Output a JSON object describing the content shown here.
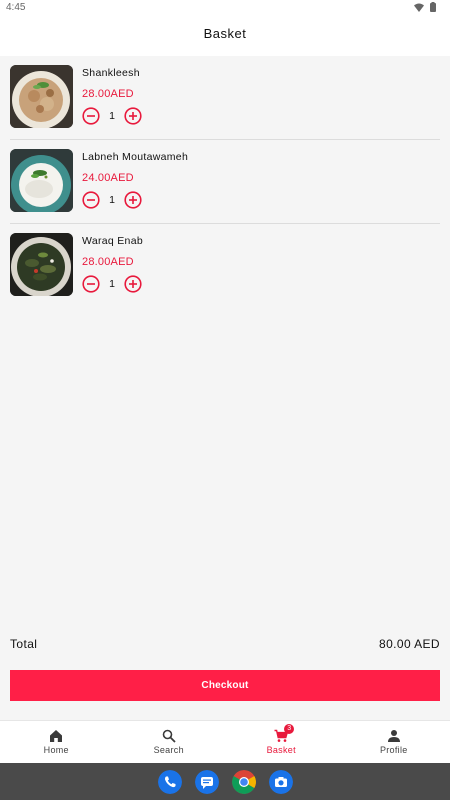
{
  "status_bar": {
    "time": "4:45"
  },
  "header": {
    "title": "Basket"
  },
  "items": [
    {
      "name": "Shankleesh",
      "price": "28.00AED",
      "quantity": "1"
    },
    {
      "name": "Labneh Moutawameh",
      "price": "24.00AED",
      "quantity": "1"
    },
    {
      "name": "Waraq Enab",
      "price": "28.00AED",
      "quantity": "1"
    }
  ],
  "summary": {
    "total_label": "Total",
    "total_value": "80.00 AED",
    "checkout_label": "Checkout"
  },
  "nav": {
    "items": [
      {
        "label": "Home",
        "icon": "home-icon"
      },
      {
        "label": "Search",
        "icon": "search-icon"
      },
      {
        "label": "Basket",
        "icon": "cart-icon",
        "badge": "3"
      },
      {
        "label": "Profile",
        "icon": "person-icon"
      }
    ],
    "active": "Basket"
  },
  "dock": {
    "apps": [
      "phone-icon",
      "messages-icon",
      "chrome-icon",
      "camera-icon"
    ]
  },
  "colors": {
    "accent": "#e8193c",
    "button": "#ff1f47",
    "background": "#f5f5f5"
  }
}
